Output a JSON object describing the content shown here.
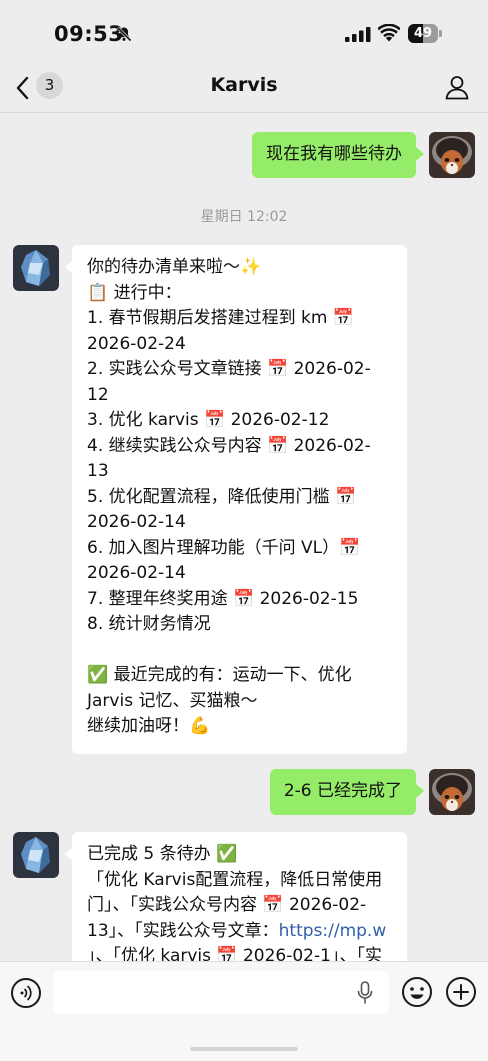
{
  "status_bar": {
    "time": "09:53",
    "battery": "49",
    "battery_level": 0.49
  },
  "nav": {
    "unread_count": "3",
    "title": "Karvis"
  },
  "messages": {
    "m1": {
      "text": "现在我有哪些待办"
    },
    "timestamp": "星期日 12:02",
    "m2": {
      "lines": [
        "你的待办清单来啦～✨",
        "📋 进行中：",
        "1. 春节假期后发搭建过程到 km 📅",
        "2026-02-24",
        "2. 实践公众号文章链接 📅 2026-02-",
        "12",
        "3. 优化 karvis 📅 2026-02-12",
        "4. 继续实践公众号内容 📅 2026-02-",
        "13",
        "5. 优化配置流程，降低使用门槛 📅",
        "2026-02-14",
        "6. 加入图片理解功能（千问 VL）📅",
        "2026-02-14",
        "7. 整理年终奖用途 📅 2026-02-15",
        "8. 统计财务情况",
        "",
        "✅ 最近完成的有：运动一下、优化",
        "Jarvis 记忆、买猫粮～",
        "继续加油呀！💪"
      ]
    },
    "m3": {
      "text": "2-6 已经完成了"
    },
    "m4": {
      "line1": "已完成 5 条待办 ✅",
      "line2": "「优化 Karvis配置流程，降低日常使用",
      "line3": "门」、「实践公众号内容 📅 2026-02-",
      "line4_text": "13」、「实践公众号文章：",
      "line4_link": "https://mp.w",
      "line5": "」、「优化 karvis 📅 2026-02-1」、「实"
    }
  },
  "input": {
    "placeholder": ""
  },
  "colors": {
    "outgoing_bubble": "#95ec69",
    "incoming_bubble": "#ffffff",
    "background": "#ededed",
    "link": "#2f5fa8"
  }
}
